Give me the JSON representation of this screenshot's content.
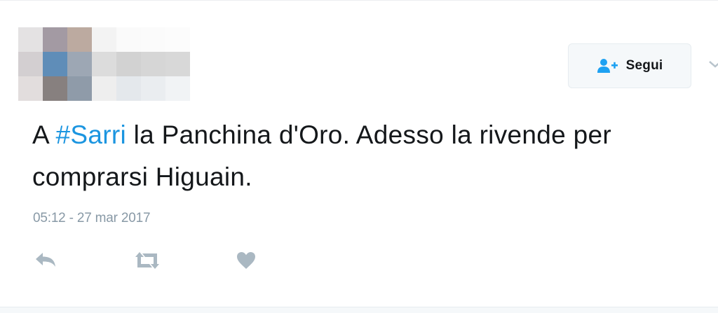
{
  "follow_button": {
    "label": "Segui",
    "icon": "follow-user-icon"
  },
  "tweet": {
    "text_before": "A ",
    "hashtag": "#Sarri",
    "text_after": " la Panchina d'Oro. Adesso la rivende per comprarsi Higuain.",
    "timestamp": "05:12 - 27 mar 2017"
  },
  "actions": [
    {
      "name": "reply",
      "icon": "reply-icon"
    },
    {
      "name": "retweet",
      "icon": "retweet-icon"
    },
    {
      "name": "like",
      "icon": "heart-icon"
    }
  ],
  "colors": {
    "hashtag": "#1b95e0",
    "text": "#14171a",
    "muted": "#8899a6",
    "icon": "#aab8c2",
    "follow_icon": "#1da1f2"
  }
}
